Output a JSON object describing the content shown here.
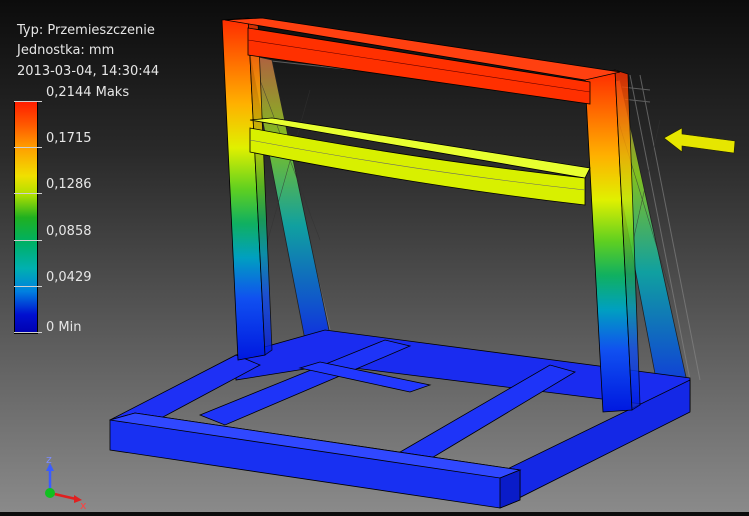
{
  "result": {
    "type_line": "Typ: Przemieszczenie",
    "unit_line": "Jednostka: mm",
    "timestamp": "2013-03-04, 14:30:44"
  },
  "legend": {
    "ticks": [
      {
        "label": "0,2144 Maks"
      },
      {
        "label": "0,1715"
      },
      {
        "label": "0,1286"
      },
      {
        "label": "0,0858"
      },
      {
        "label": "0,0429"
      },
      {
        "label": "0 Min"
      }
    ]
  },
  "triad": {
    "z_label": "z",
    "x_label": "x"
  },
  "colors": {
    "high": "#ff1e00",
    "mid": "#e8f000",
    "low": "#0010d0",
    "load_arrow": "#e6e600"
  }
}
